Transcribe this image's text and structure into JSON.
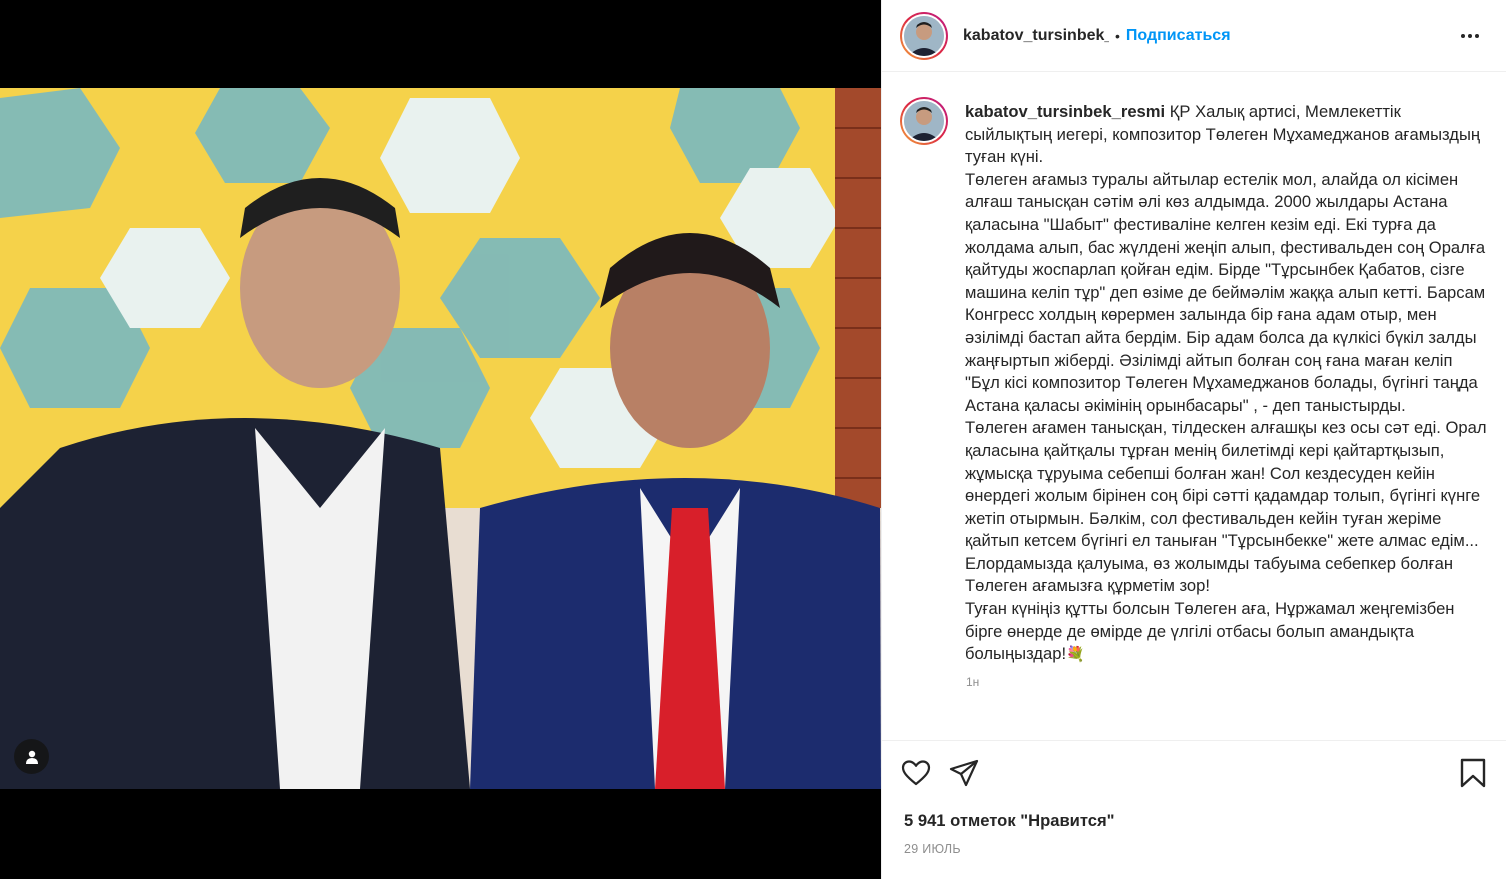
{
  "post": {
    "media_alt": "Photo",
    "tag_icon": "user-tag-icon"
  },
  "header": {
    "username": "kabatov_tursinbek_resmi",
    "separator": "•",
    "follow_label": "Подписаться",
    "more_icon": "more-options-icon"
  },
  "caption": {
    "username": "kabatov_tursinbek_resmi",
    "text": "ҚР Халық артисі, Мемлекеттік сыйлықтың иегері, композитор Төлеген Мұхамеджанов ағамыздың туған күні.\nТөлеген ағамыз туралы айтылар естелік мол, алайда ол кісімен алғаш танысқан сәтім әлі көз алдымда. 2000 жылдары Астана қаласына \"Шабыт\" фестиваліне келген кезім еді. Екі турға да жолдама алып, бас жүлдені жеңіп алып, фестивальден соң Оралға қайтуды жоспарлап қойған едім. Бірде \"Тұрсынбек Қабатов, сізге машина келіп тұр\" деп өзіме де беймәлім жаққа алып кетті. Барсам Конгресс холдың көрермен залында бір ғана адам отыр, мен әзілімді бастап айта бердім. Бір адам болса да күлкісі бүкіл залды жаңғыртып жіберді. Әзілімді айтып болған соң ғана маған келіп \"Бұл кісі композитор Төлеген Мұхамеджанов болады, бүгінгі таңда Астана қаласы әкімінің орынбасары\" , - деп таныстырды.\nТөлеген ағамен танысқан, тілдескен алғашқы кез осы сәт еді. Орал қаласына қайтқалы тұрған менің билетімді кері қайтартқызып, жұмысқа тұруыма себепші болған жан! Сол кездесуден кейін өнердегі жолым бірінен соң бірі сәтті қадамдар толып, бүгінгі күнге жетіп отырмын. Бәлкім, сол фестивальден кейін туған жеріме қайтып кетсем бүгінгі ел таныған \"Тұрсынбекке\" жете алмас едім... Елордамызда қалуыма, өз жолымды табуыма себепкер болған Төлеген ағамызға құрметім зор!\nТуған күніңіз құтты болсын Төлеген аға, Нұржамал жеңгемізбен бірге өнерде де өмірде де үлгілі отбасы болып амандықта болыңыздар!",
    "emoji": "💐",
    "time_short": "1н"
  },
  "actions": {
    "like_icon": "heart-icon",
    "share_icon": "share-icon",
    "save_icon": "bookmark-icon",
    "likes_text": "5 941 отметок \"Нравится\"",
    "date_text": "29 ИЮЛЬ"
  },
  "colors": {
    "accent": "#0095f6",
    "text": "#262626",
    "muted": "#8e8e8e",
    "border": "#efefef"
  }
}
